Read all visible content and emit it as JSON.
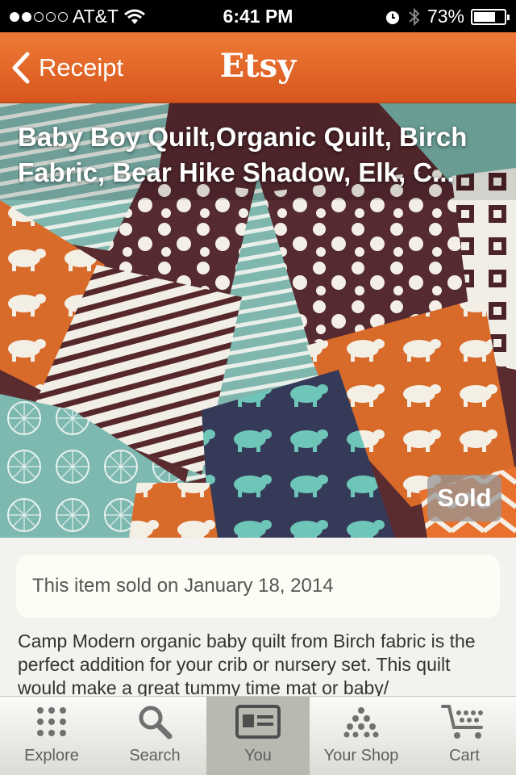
{
  "status_bar": {
    "carrier": "AT&T",
    "signal_bars_filled": 2,
    "signal_bars_total": 5,
    "time": "6:41 PM",
    "battery": "73%",
    "battery_level": 0.73
  },
  "nav": {
    "back_label": "Receipt",
    "title": "Etsy",
    "accent_color": "#e46a2a"
  },
  "listing": {
    "title": "Baby Boy Quilt,Organic Quilt, Birch Fabric, Bear Hike Shadow, Elk, C...",
    "image_count": 5,
    "active_image": 0,
    "sold_badge": "Sold",
    "sold_notice": "This item sold on January 18, 2014",
    "description": "Camp Modern organic baby quilt from Birch fabric is the perfect addition for your crib or nursery set. This quilt would make a great tummy time mat or baby/"
  },
  "tabs": [
    {
      "label": "Explore",
      "icon": "explore-grid-icon",
      "active": false
    },
    {
      "label": "Search",
      "icon": "magnifier-icon",
      "active": false
    },
    {
      "label": "You",
      "icon": "id-card-icon",
      "active": true
    },
    {
      "label": "Your Shop",
      "icon": "shop-pyramid-icon",
      "active": false
    },
    {
      "label": "Cart",
      "icon": "cart-icon",
      "active": false
    }
  ]
}
